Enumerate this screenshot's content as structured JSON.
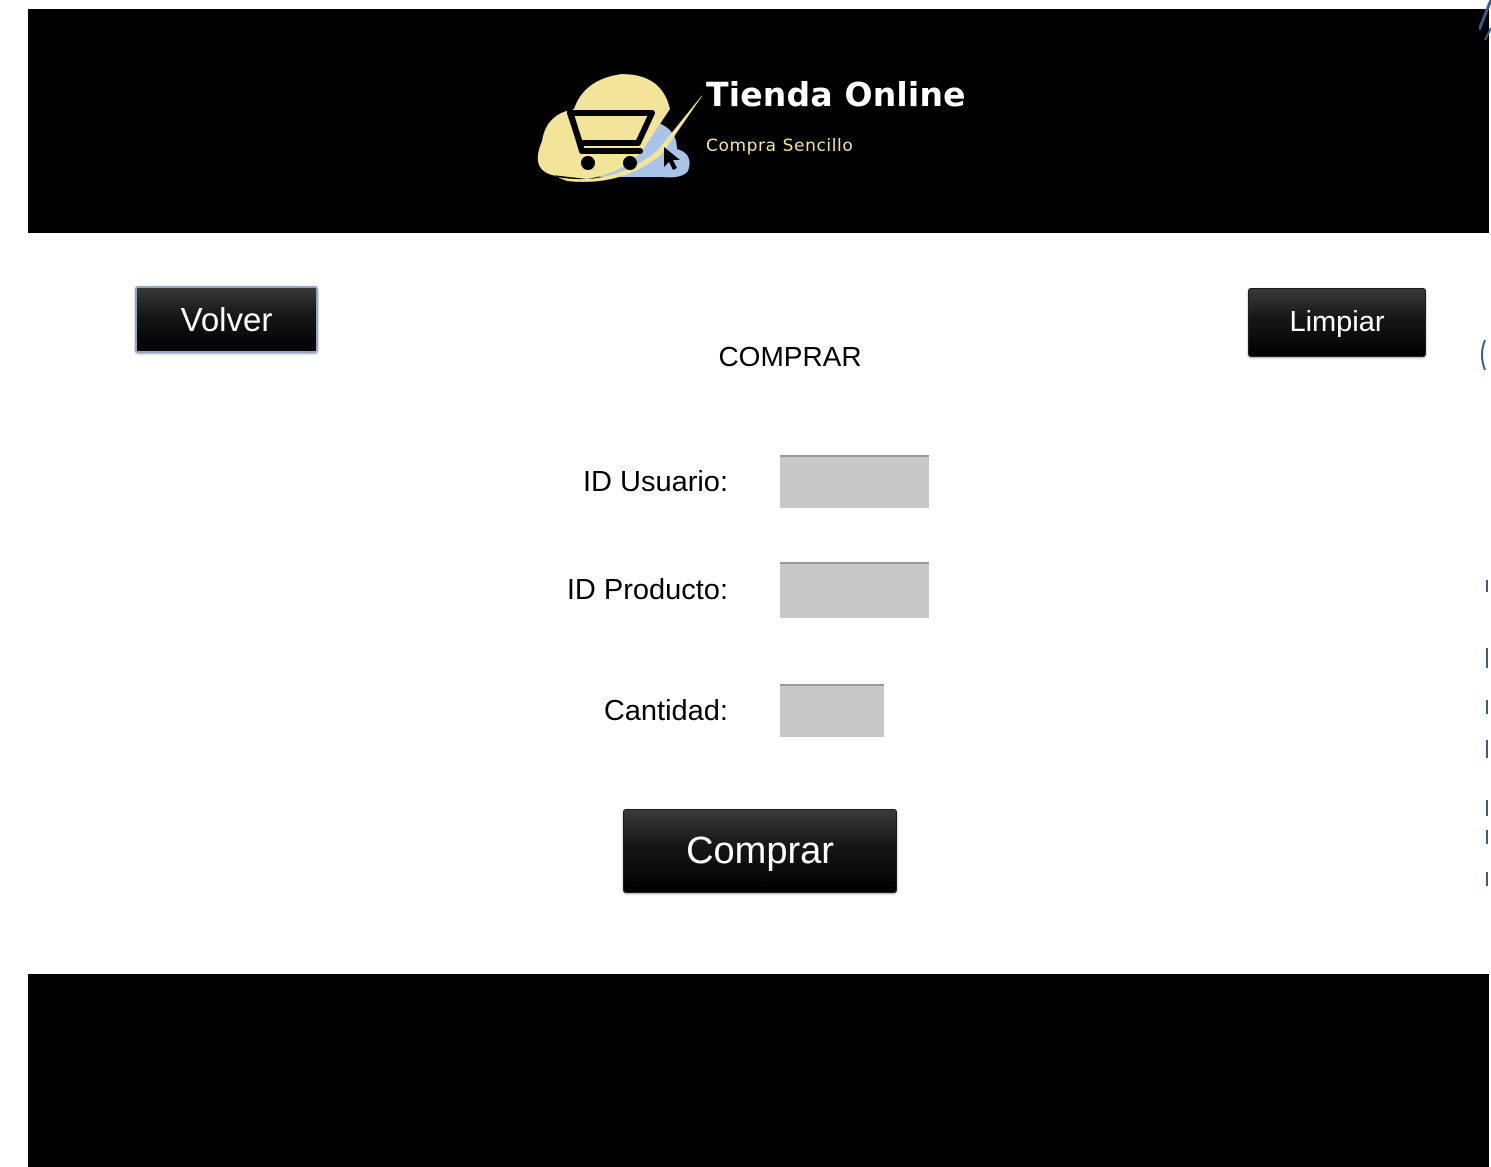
{
  "header": {
    "brand_title": "Tienda Online",
    "brand_subtitle": "Compra Sencillo",
    "logo_icon": "shopping-cart-cloud-logo"
  },
  "toolbar": {
    "back_label": "Volver",
    "clear_label": "Limpiar"
  },
  "main": {
    "title": "COMPRAR",
    "fields": {
      "user_id": {
        "label": "ID Usuario:",
        "value": ""
      },
      "product_id": {
        "label": "ID Producto:",
        "value": ""
      },
      "quantity": {
        "label": "Cantidad:",
        "value": ""
      }
    },
    "submit_label": "Comprar"
  },
  "colors": {
    "header_bg": "#000000",
    "footer_bg": "#000000",
    "logo_yellow": "#f2e59a",
    "logo_blue": "#a9c4e8",
    "input_bg": "#c8c8c8",
    "focus_border": "#8ea6c9"
  }
}
